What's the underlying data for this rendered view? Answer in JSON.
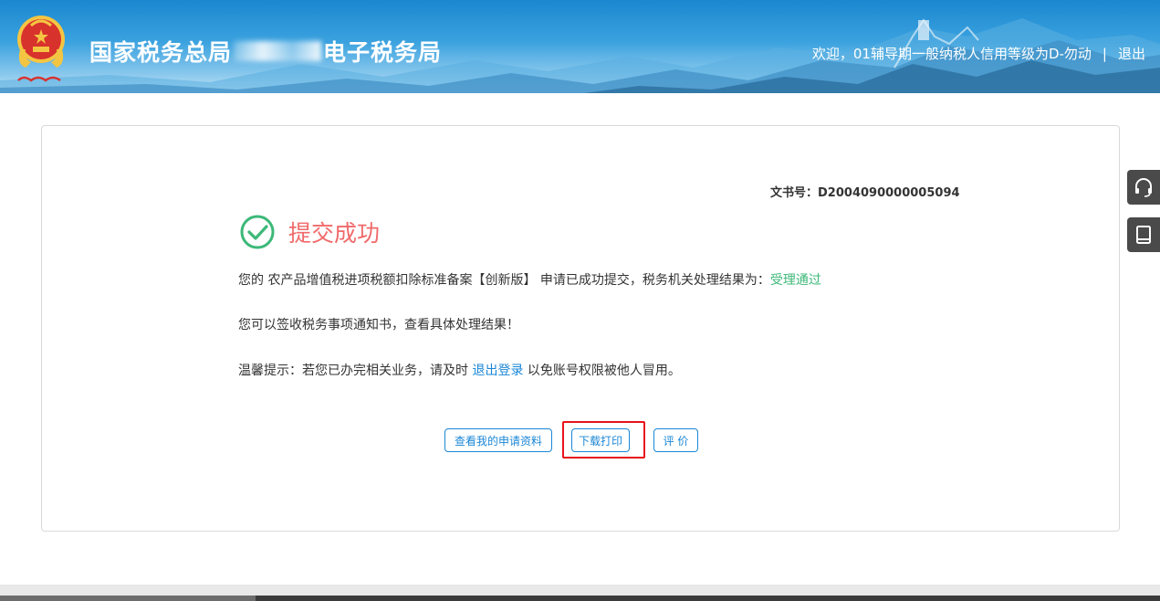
{
  "header": {
    "title_prefix": "国家税务总局",
    "title_suffix": "电子税务局",
    "emblem_text": "中国税务",
    "welcome": "欢迎，01辅导期一般纳税人信用等级为D-勿动",
    "separator": "|",
    "logout": "退出"
  },
  "result": {
    "doc_no_label": "文书号：",
    "doc_no": "D2004090000005094",
    "title": "提交成功",
    "line1_a": "您的 农产品增值税进项税额扣除标准备案【创新版】 申请已成功提交，税务机关处理结果为：",
    "line1_status": "受理通过",
    "line2": "您可以签收税务事项通知书，查看具体处理结果！",
    "line3_a": "温馨提示：若您已办完相关业务，请及时",
    "line3_link": "退出登录",
    "line3_b": "以免账号权限被他人冒用。"
  },
  "actions": {
    "view_label": "查看我的申请资料",
    "download_label": "下载打印",
    "rate_label": "评 价"
  },
  "side": {
    "support_icon": "headset-icon",
    "guide_icon": "book-icon"
  },
  "colors": {
    "header_blue": "#1a87cf",
    "success_red": "#f06a6a",
    "status_green": "#3cb878",
    "link_blue": "#1a87d6",
    "highlight_red": "#e8131a"
  }
}
